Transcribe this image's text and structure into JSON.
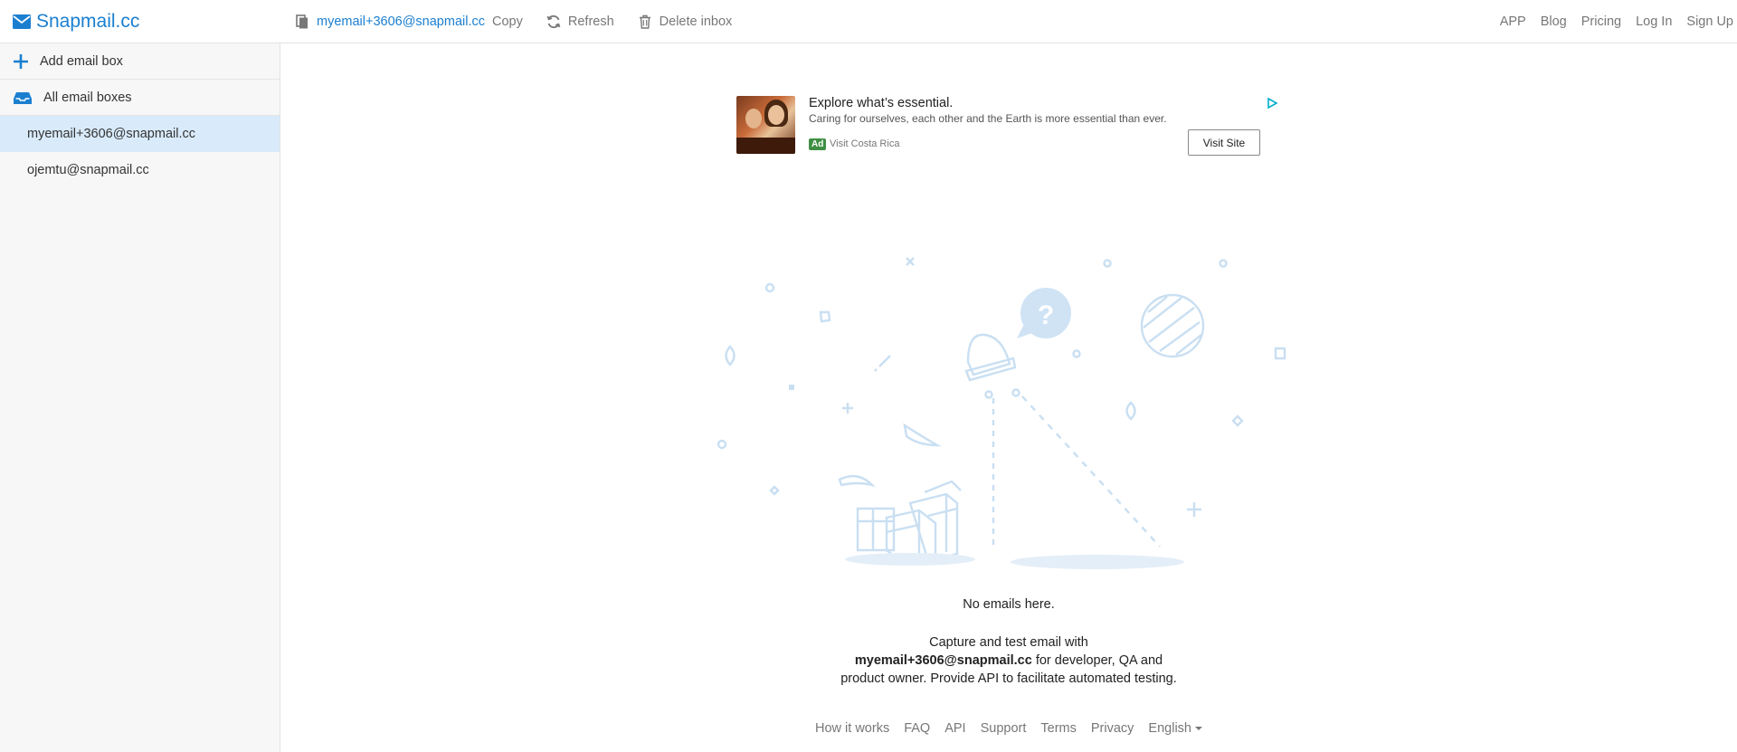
{
  "header": {
    "brand": "Snapmail.cc",
    "email": "myemail+3606@snapmail.cc",
    "copy_label": "Copy",
    "refresh_label": "Refresh",
    "delete_label": "Delete inbox",
    "nav": [
      "APP",
      "Blog",
      "Pricing",
      "Log In",
      "Sign Up"
    ]
  },
  "sidebar": {
    "add_label": "Add email box",
    "all_label": "All email boxes",
    "mailboxes": [
      "myemail+3606@snapmail.cc",
      "ojemtu@snapmail.cc"
    ],
    "active_index": 0
  },
  "ad": {
    "title": "Explore what’s essential.",
    "description": "Caring for ourselves, each other and the Earth is more essential than ever.",
    "badge": "Ad",
    "advertiser": "Visit Costa Rica",
    "button": "Visit Site"
  },
  "empty": {
    "title": "No emails here.",
    "desc_prefix": "Capture and test email with",
    "email": "myemail+3606@snapmail.cc",
    "desc_mid": "for developer, QA and",
    "desc_end": "product owner. Provide API to facilitate automated testing."
  },
  "footer": {
    "links": [
      "How it works",
      "FAQ",
      "API",
      "Support",
      "Terms",
      "Privacy"
    ],
    "language": "English"
  },
  "colors": {
    "accent": "#1b7fd0",
    "active_row": "#d9ebfb",
    "illustration": "#c9dff2"
  }
}
